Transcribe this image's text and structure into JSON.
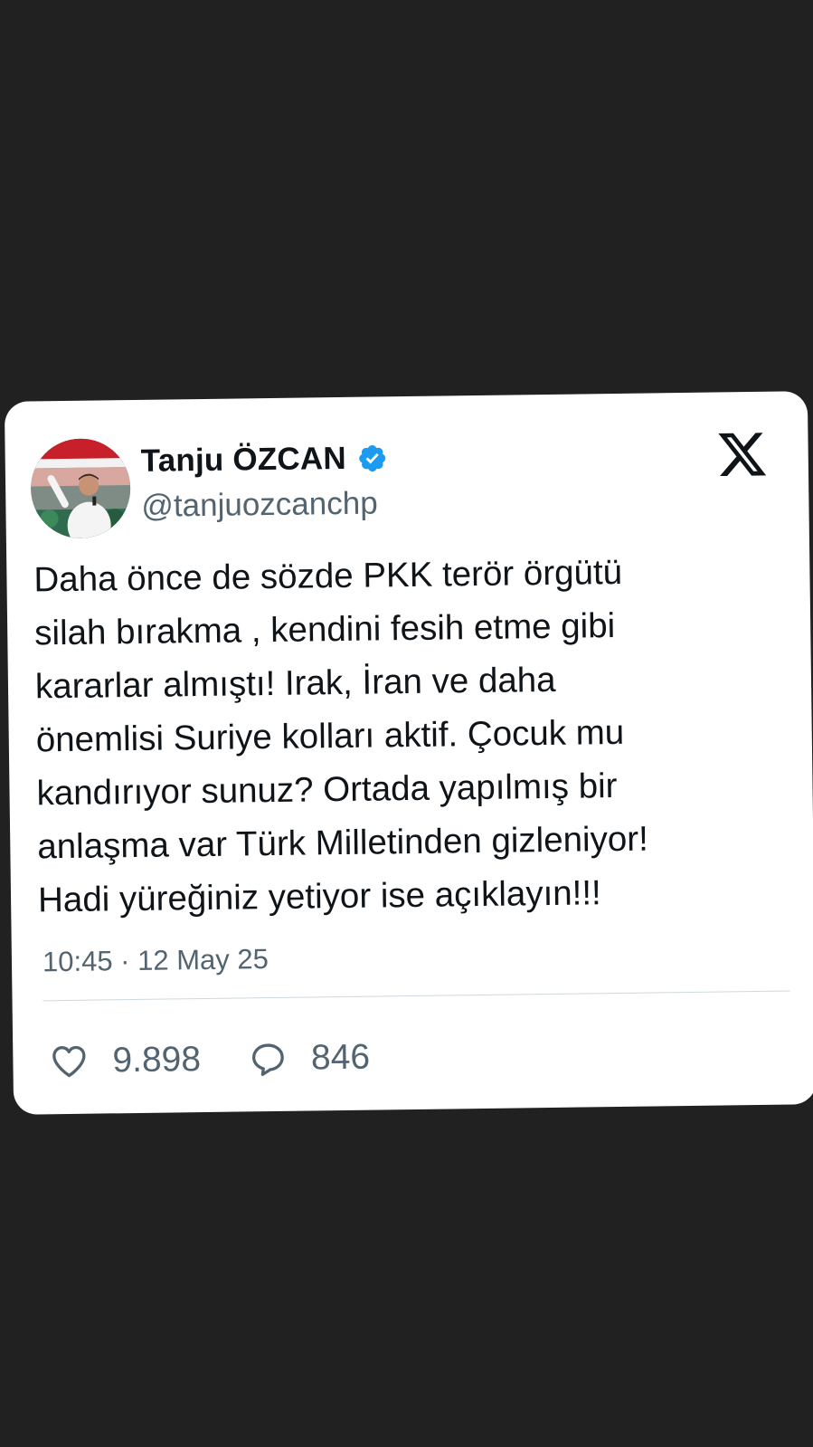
{
  "tweet": {
    "author": {
      "name": "Tanju ÖZCAN",
      "handle": "@tanjuozcanchp",
      "verified": true,
      "verified_color": "#1d9bf0"
    },
    "brand_icon": "x-logo-icon",
    "text": "Daha önce de sözde PKK terör örgütü\nsilah bırakma , kendini fesih etme gibi\nkararlar almıştı! Irak, İran ve daha\nönemlisi Suriye kolları aktif. Çocuk mu\nkandırıyor sunuz? Ortada yapılmış bir\nanlaşma var Türk Milletinden gizleniyor!\nHadi yüreğiniz yetiyor ise açıklayın!!!",
    "timestamp": "10:45 · 12 May 25",
    "stats": {
      "likes": "9.898",
      "replies": "846"
    },
    "icons": {
      "like": "heart-icon",
      "reply": "reply-icon",
      "verified": "verified-badge-icon"
    }
  },
  "colors": {
    "background": "#212121",
    "card": "#ffffff",
    "text_primary": "#0f1419",
    "text_secondary": "#536471",
    "divider": "#cfd9de"
  }
}
